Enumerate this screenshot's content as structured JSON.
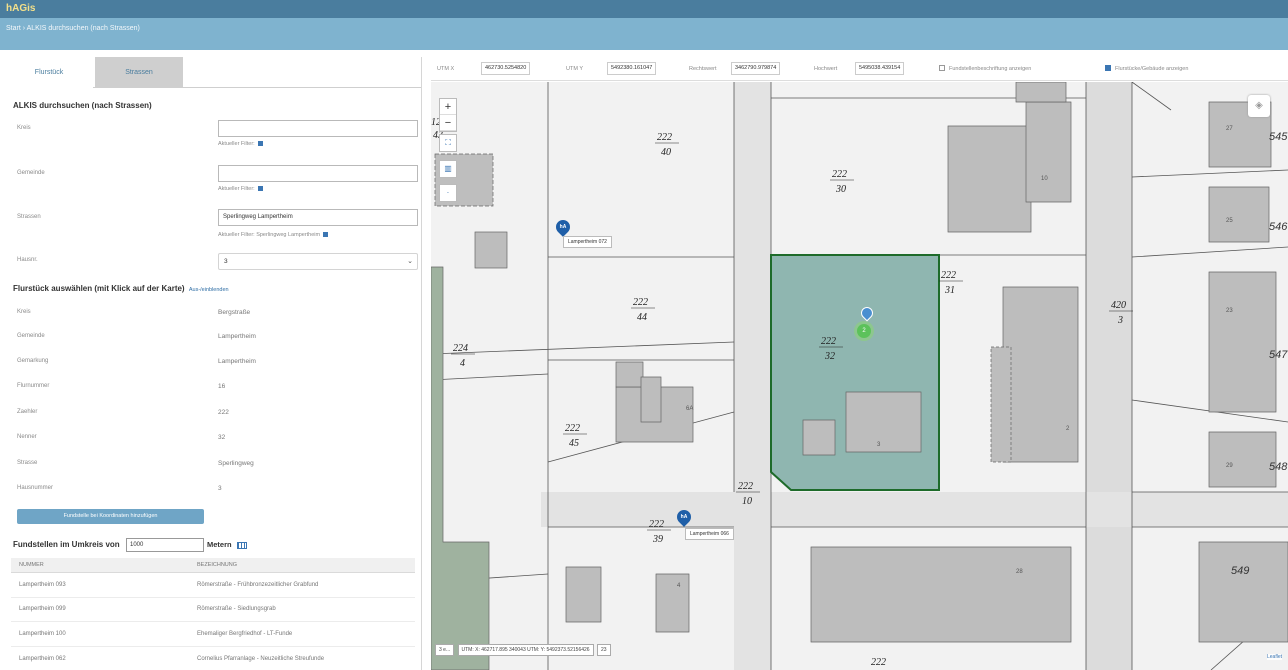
{
  "app": {
    "title": "hAGis",
    "breadcrumb": "Start › ALKIS durchsuchen (nach Strassen)"
  },
  "tabs": [
    {
      "label": "Flurstück"
    },
    {
      "label": "Strassen"
    }
  ],
  "search": {
    "heading": "ALKIS durchsuchen (nach Strassen)",
    "kreis_label": "Kreis",
    "kreis_value": "",
    "kreis_hint": "Aktueller Filter:",
    "gemeinde_label": "Gemeinde",
    "gemeinde_value": "",
    "gemeinde_hint": "Aktueller Filter:",
    "strasse_label": "Strassen",
    "strasse_value": "Sperlingweg Lampertheim",
    "strasse_hint": "Aktueller Filter: Sperlingweg Lampertheim",
    "hausnr_label": "Hausnr.",
    "hausnr_value": "3"
  },
  "flurstueck": {
    "heading": "Flurstück auswählen (mit Klick auf der Karte)",
    "toggle_link": "Aus-/einblenden",
    "rows": [
      {
        "label": "Kreis",
        "value": "Bergstraße"
      },
      {
        "label": "Gemeinde",
        "value": "Lampertheim"
      },
      {
        "label": "Gemarkung",
        "value": "Lampertheim"
      },
      {
        "label": "Flurnummer",
        "value": "16"
      },
      {
        "label": "Zaehler",
        "value": "222"
      },
      {
        "label": "Nenner",
        "value": "32"
      },
      {
        "label": "Strasse",
        "value": "Sperlingweg"
      },
      {
        "label": "Hausnummer",
        "value": "3"
      }
    ],
    "add_button": "Fundstelle bei Koordinaten hinzufügen"
  },
  "fundstellen": {
    "heading": "Fundstellen im Umkreis von",
    "radius": "1000",
    "unit": "Metern",
    "columns": [
      "Nummer",
      "Bezeichnung"
    ],
    "rows": [
      {
        "nummer": "Lampertheim 093",
        "bezeichnung": "Römerstraße - Frühbronzezeitlicher Grabfund"
      },
      {
        "nummer": "Lampertheim 099",
        "bezeichnung": "Römerstraße - Siedlungsgrab"
      },
      {
        "nummer": "Lampertheim 100",
        "bezeichnung": "Ehemaliger Bergfriedhof - LT-Funde"
      },
      {
        "nummer": "Lampertheim 062",
        "bezeichnung": "Cornelius Pfarranlage - Neuzeitliche Streufunde"
      }
    ]
  },
  "coords": {
    "utm_x_label": "UTM X",
    "utm_x": "462730.5254820",
    "utm_y_label": "UTM Y",
    "utm_y": "5492380.161047",
    "rechtswert_label": "Rechtswert",
    "rechtswert": "3462790.979874",
    "hochwert_label": "Hochwert",
    "hochwert": "5495038.439154",
    "option1": "Fundstellenbeschriftung anzeigen",
    "option2": "Flurstücke/Gebäude anzeigen"
  },
  "map": {
    "parcels": [
      {
        "num": "222",
        "den": "40"
      },
      {
        "num": "222",
        "den": "30"
      },
      {
        "num": "222",
        "den": "44"
      },
      {
        "num": "222",
        "den": "31"
      },
      {
        "num": "222",
        "den": "32"
      },
      {
        "num": "224",
        "den": "4"
      },
      {
        "num": "420",
        "den": "3"
      },
      {
        "num": "222",
        "den": "45"
      },
      {
        "num": "222",
        "den": "10"
      },
      {
        "num": "222",
        "den": "39"
      }
    ],
    "house_numbers": [
      "545",
      "546",
      "547",
      "548",
      "549",
      "27",
      "25",
      "23",
      "29",
      "28",
      "10",
      "6A",
      "3",
      "4",
      "2"
    ],
    "pin1_label": "Lampertheim 072",
    "pin2_label": "Lampertheim 066",
    "pin_text": "hA",
    "cluster_count": "2",
    "partial_labels": [
      "12",
      "43",
      "222"
    ],
    "bottom": [
      "3 e...",
      "UTM: X: 462717.895 340043 UTM: Y: 5492373.52156426",
      "23"
    ],
    "attribution": "Leaflet"
  },
  "colors": {
    "appbar": "#4a7d9e",
    "crumbbar": "#7fb3cf",
    "selected_parcel": "#8fb6b0",
    "parcel_border": "#1e6b2a"
  }
}
